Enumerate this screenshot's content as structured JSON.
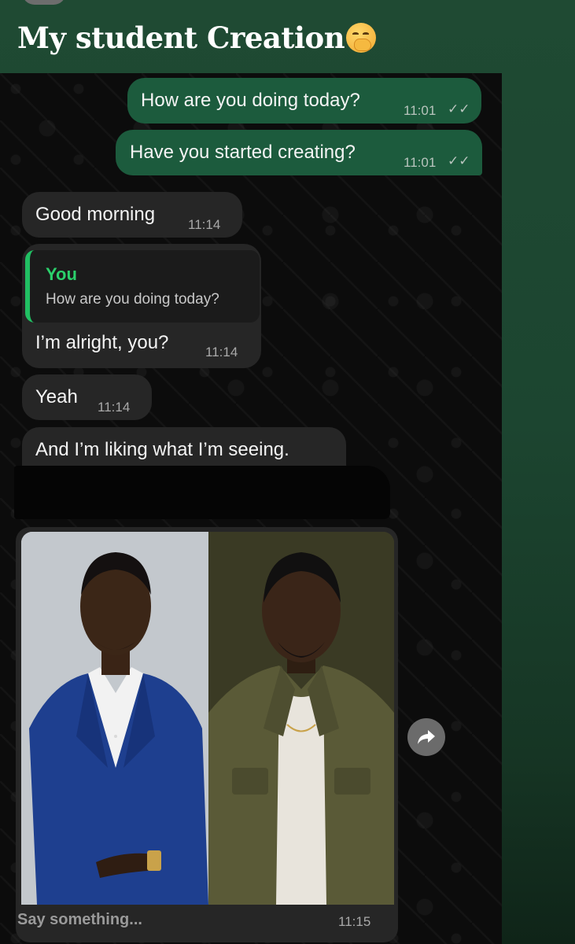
{
  "story": {
    "title": "My student Creation",
    "title_emoji": "face-with-hand-over-mouth"
  },
  "messages": [
    {
      "direction": "out",
      "text": "How are you doing today?",
      "time": "11:01",
      "status": "read"
    },
    {
      "direction": "out",
      "text": "Have you started creating?",
      "time": "11:01",
      "status": "read"
    },
    {
      "direction": "in",
      "text": "Good morning",
      "time": "11:14"
    },
    {
      "direction": "in",
      "reply_to": {
        "name": "You",
        "text": "How are you doing today?"
      },
      "text": "I’m alright, you?",
      "time": "11:14"
    },
    {
      "direction": "in",
      "text": "Yeah",
      "time": "11:14"
    },
    {
      "direction": "in",
      "text": "And I’m liking what I’m seeing.",
      "time": ""
    }
  ],
  "photo_message": {
    "caption_placeholder": "Say something...",
    "time": "11:15"
  },
  "icons": {
    "tick": "double-check-icon",
    "forward": "forward-arrow-icon"
  },
  "colors": {
    "outgoing_bubble": "#1c5b3d",
    "incoming_bubble": "#262626",
    "reply_accent": "#21c063",
    "header_bg": "#1f4a33"
  }
}
